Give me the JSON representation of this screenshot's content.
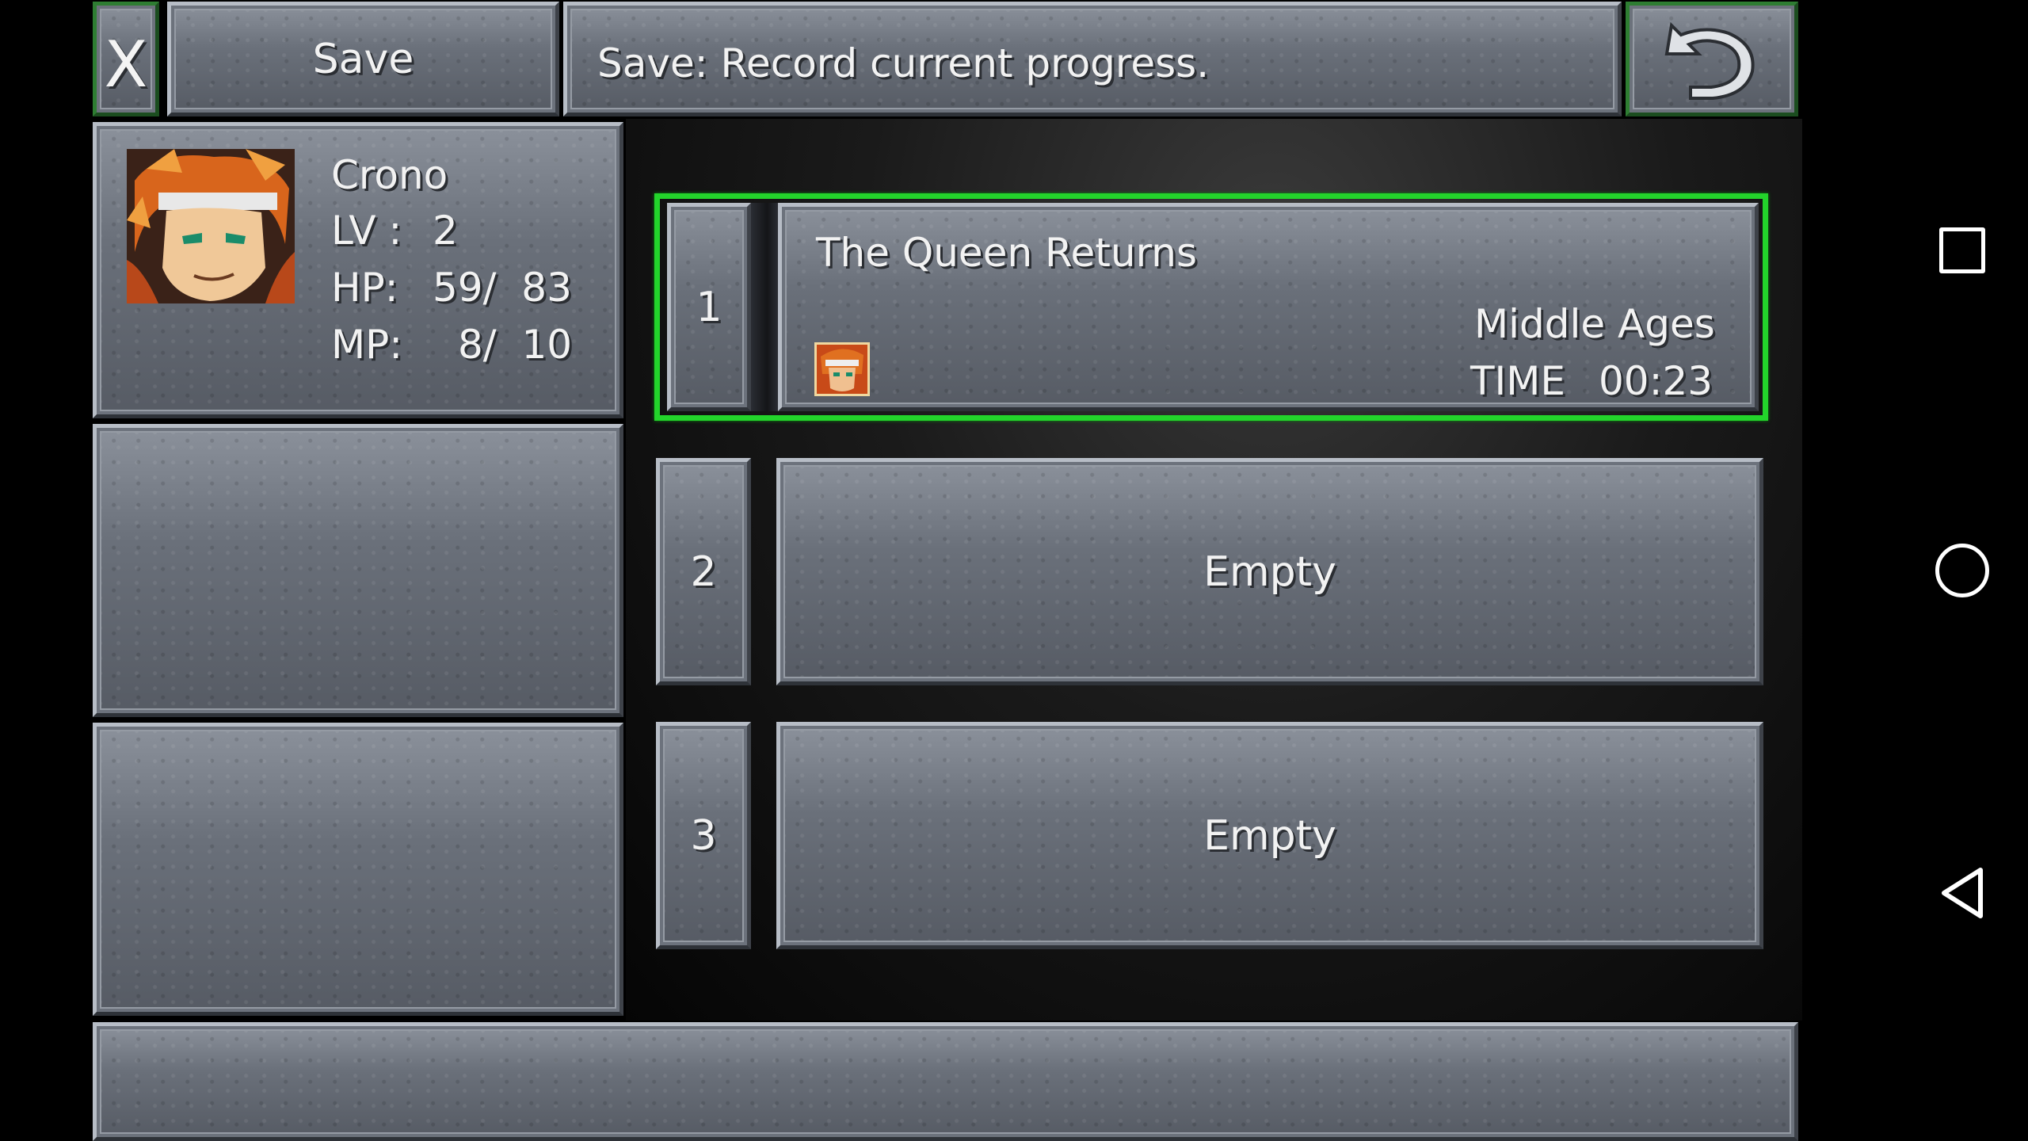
{
  "header": {
    "close_label": "X",
    "title": "Save",
    "description": "Save: Record current progress."
  },
  "party": [
    {
      "name": "Crono",
      "lv_label": "LV :",
      "lv_value": "2",
      "hp_label": "HP:",
      "hp_value": "59/  83",
      "mp_label": "MP:",
      "mp_value": "8/  10"
    }
  ],
  "slots": [
    {
      "number": "1",
      "chapter": "The Queen Returns",
      "era": "Middle Ages",
      "time_label": "TIME",
      "time_value": "00:23",
      "selected": true
    },
    {
      "number": "2",
      "label": "Empty"
    },
    {
      "number": "3",
      "label": "Empty"
    }
  ],
  "colors": {
    "selection_border": "#23d42b",
    "panel": "#6a707a",
    "background": "#000000"
  },
  "icons": {
    "close": "close-x-icon",
    "back": "return-arrow-icon",
    "nav_recent": "square-icon",
    "nav_home": "circle-icon",
    "nav_back": "triangle-back-icon"
  }
}
